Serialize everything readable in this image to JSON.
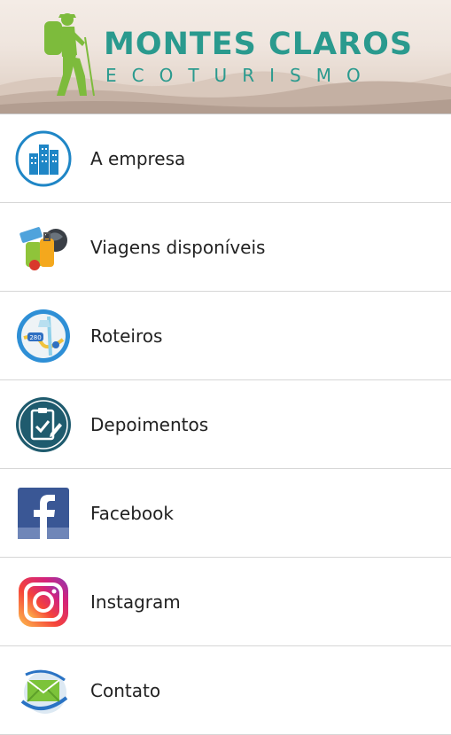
{
  "header": {
    "title": "MONTES CLAROS",
    "subtitle": "ECOTURISMO",
    "brand_color": "#2a9a8e",
    "logo_icon": "hiker-icon"
  },
  "menu": {
    "items": [
      {
        "label": "A empresa",
        "icon": "buildings-icon"
      },
      {
        "label": "Viagens disponíveis",
        "icon": "luggage-globe-icon"
      },
      {
        "label": "Roteiros",
        "icon": "map-icon"
      },
      {
        "label": "Depoimentos",
        "icon": "clipboard-check-icon"
      },
      {
        "label": "Facebook",
        "icon": "facebook-icon"
      },
      {
        "label": "Instagram",
        "icon": "instagram-icon"
      },
      {
        "label": "Contato",
        "icon": "envelope-globe-icon"
      }
    ],
    "map_icon_sign": "280"
  }
}
